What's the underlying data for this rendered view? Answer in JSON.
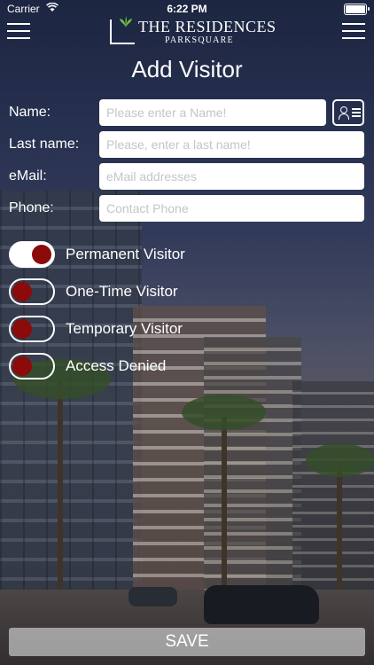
{
  "status_bar": {
    "carrier": "Carrier",
    "time": "6:22 PM",
    "wifi_icon": "wifi-icon",
    "battery_level": 1.0
  },
  "header": {
    "logo_title": "THE RESIDENCES",
    "logo_subtitle": "PARKSQUARE",
    "left_icon": "hamburger-menu-icon",
    "right_icon": "hamburger-menu-icon"
  },
  "page": {
    "title": "Add Visitor"
  },
  "form": {
    "name": {
      "label": "Name:",
      "placeholder": "Please enter a Name!",
      "value": ""
    },
    "last_name": {
      "label": "Last name:",
      "placeholder": "Please, enter a last name!",
      "value": ""
    },
    "email": {
      "label": "eMail:",
      "placeholder": "eMail addresses",
      "value": ""
    },
    "phone": {
      "label": "Phone:",
      "placeholder": "Contact Phone",
      "value": ""
    },
    "contact_card_icon": "contact-card-icon"
  },
  "visitor_types": [
    {
      "label": "Permanent Visitor",
      "on": true
    },
    {
      "label": "One-Time Visitor",
      "on": false
    },
    {
      "label": "Temporary Visitor",
      "on": false
    },
    {
      "label": "Access Denied",
      "on": false
    }
  ],
  "colors": {
    "knob": "#8b0a0a",
    "field_bg": "#ffffff",
    "save_bg": "#c8c8c8"
  },
  "save_button": {
    "label": "SAVE"
  }
}
